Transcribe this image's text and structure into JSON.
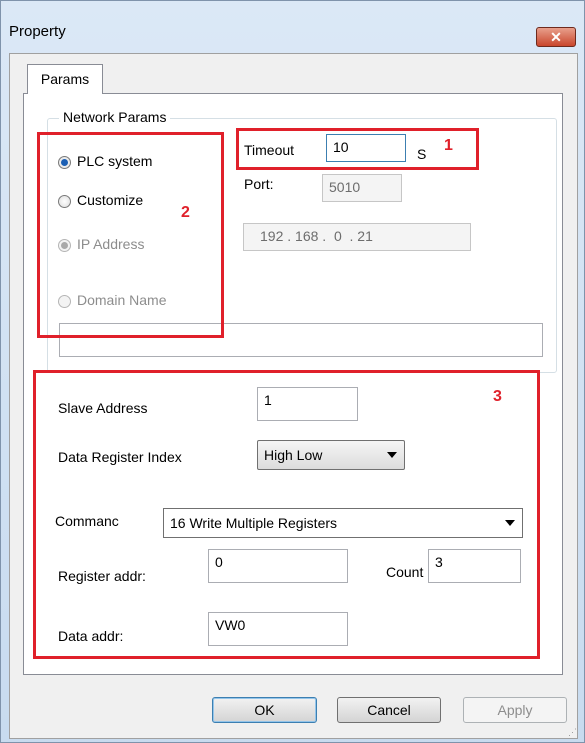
{
  "window": {
    "title": "Property",
    "close_glyph": "✕"
  },
  "tabs": [
    {
      "label": "Params"
    }
  ],
  "network": {
    "group_label": "Network Params",
    "radios": {
      "plc_system": {
        "label": "PLC system",
        "selected": true,
        "enabled": true
      },
      "customize": {
        "label": "Customize",
        "selected": false,
        "enabled": true
      },
      "ip_address": {
        "label": "IP Address",
        "selected": true,
        "enabled": false
      },
      "domain_name": {
        "label": "Domain Name",
        "selected": false,
        "enabled": false
      }
    },
    "timeout": {
      "label": "Timeout",
      "value": "10",
      "unit": "S"
    },
    "port": {
      "label": "Port:",
      "value": "5010"
    },
    "ip": {
      "value": "192 . 168 .  0  . 21"
    },
    "domain": {
      "value": ""
    }
  },
  "modbus": {
    "slave_address": {
      "label": "Slave Address",
      "value": "1"
    },
    "data_register_index": {
      "label": "Data Register Index",
      "selected": "High Low"
    },
    "command": {
      "label": "Commanc",
      "selected": "16 Write Multiple Registers"
    },
    "register_addr": {
      "label": "Register addr:",
      "value": "0"
    },
    "count": {
      "label": "Count",
      "value": "3"
    },
    "data_addr": {
      "label": "Data addr:",
      "value": "VW0"
    }
  },
  "annotations": {
    "box1": "1",
    "box2": "2",
    "box3": "3",
    "color": "#e0202a"
  },
  "buttons": {
    "ok": "OK",
    "cancel": "Cancel",
    "apply": "Apply"
  }
}
